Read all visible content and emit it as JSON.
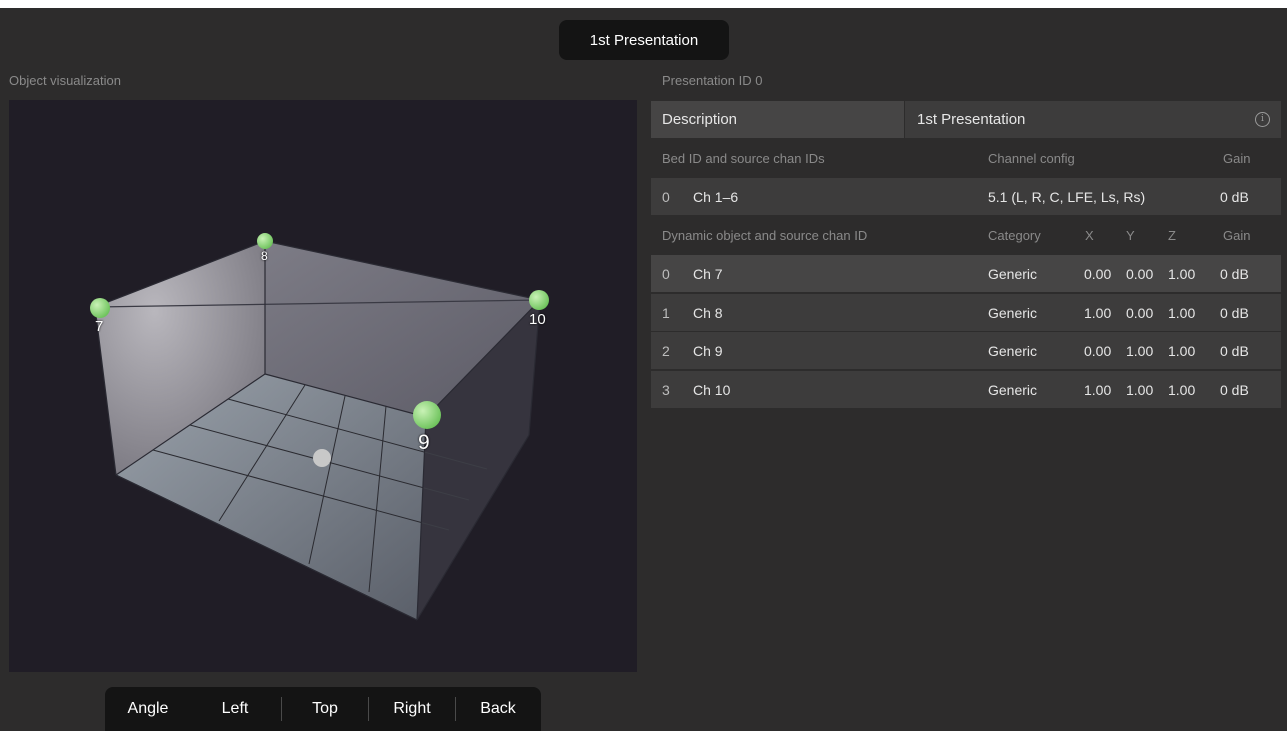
{
  "presentation_tab": {
    "label": "1st Presentation"
  },
  "visualization": {
    "section_label": "Object visualization",
    "objects": [
      {
        "label": "7"
      },
      {
        "label": "8"
      },
      {
        "label": "10"
      },
      {
        "label": "9"
      }
    ],
    "object_color": "#7fd06a",
    "listener_color": "#c8c8c8"
  },
  "view_toolbar": {
    "buttons": [
      "Angle",
      "Left",
      "Top",
      "Right",
      "Back"
    ]
  },
  "presentation": {
    "id_label": "Presentation ID 0",
    "description_label": "Description",
    "description_value": "1st Presentation",
    "info_icon": "info-icon",
    "bed_header": {
      "col1": "Bed ID and source chan IDs",
      "col2": "Channel config",
      "col3": "Gain"
    },
    "bed_rows": [
      {
        "id": "0",
        "source": "Ch 1–6",
        "config": "5.1 (L, R, C, LFE, Ls, Rs)",
        "gain": "0 dB"
      }
    ],
    "object_header": {
      "col1": "Dynamic object and source chan ID",
      "category": "Category",
      "x": "X",
      "y": "Y",
      "z": "Z",
      "gain": "Gain"
    },
    "object_rows": [
      {
        "id": "0",
        "source": "Ch 7",
        "category": "Generic",
        "x": "0.00",
        "y": "0.00",
        "z": "1.00",
        "gain": "0 dB"
      },
      {
        "id": "1",
        "source": "Ch 8",
        "category": "Generic",
        "x": "1.00",
        "y": "0.00",
        "z": "1.00",
        "gain": "0 dB"
      },
      {
        "id": "2",
        "source": "Ch 9",
        "category": "Generic",
        "x": "0.00",
        "y": "1.00",
        "z": "1.00",
        "gain": "0 dB"
      },
      {
        "id": "3",
        "source": "Ch 10",
        "category": "Generic",
        "x": "1.00",
        "y": "1.00",
        "z": "1.00",
        "gain": "0 dB"
      }
    ]
  }
}
